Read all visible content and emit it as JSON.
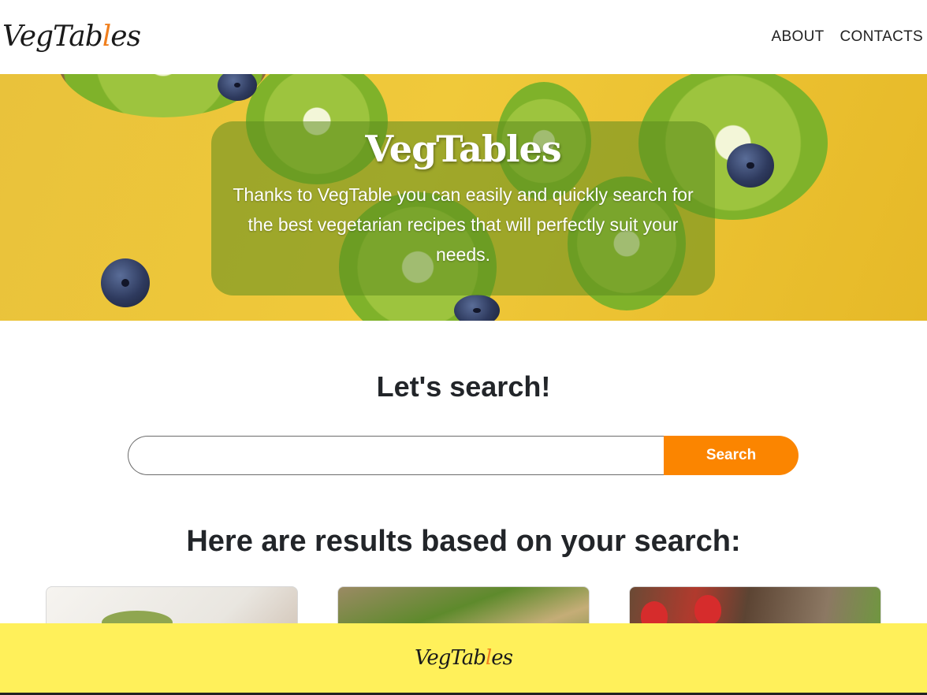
{
  "header": {
    "logo_text_a": "VegTab",
    "logo_text_carrot": "l",
    "logo_text_b": "es",
    "nav": [
      {
        "label": "ABOUT"
      },
      {
        "label": "CONTACTS"
      }
    ]
  },
  "hero": {
    "title": "VegTables",
    "text": "Thanks to VegTable you can easily and quickly search for the best vegetarian recipes that will perfectly suit your needs."
  },
  "search": {
    "heading": "Let's search!",
    "input_value": "",
    "input_placeholder": "",
    "button_label": "Search"
  },
  "results": {
    "heading": "Here are results based on your search:"
  },
  "footer": {
    "logo_text_a": "VegTab",
    "logo_text_carrot": "l",
    "logo_text_b": "es"
  },
  "colors": {
    "accent_orange": "#fb8500",
    "footer_yellow": "#fff05a",
    "hero_yellow": "#f0c93a"
  }
}
